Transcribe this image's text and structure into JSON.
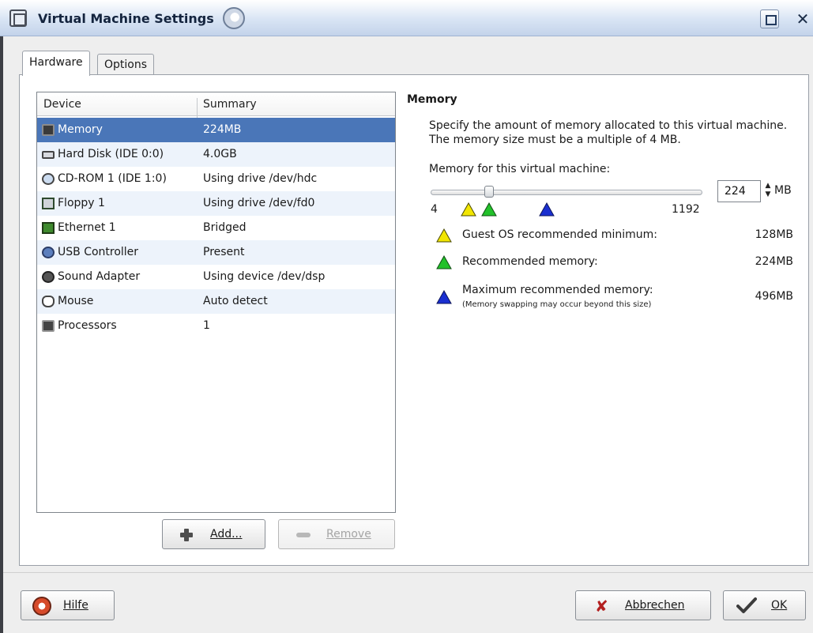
{
  "window": {
    "title": "Virtual Machine Settings"
  },
  "tabs": [
    {
      "label": "Hardware"
    },
    {
      "label": "Options"
    }
  ],
  "device_list": {
    "columns": [
      "Device",
      "Summary"
    ],
    "rows": [
      {
        "device": "Memory",
        "summary": "224MB",
        "icon": "memory-chip-icon"
      },
      {
        "device": "Hard Disk (IDE 0:0)",
        "summary": "4.0GB",
        "icon": "hard-disk-icon"
      },
      {
        "device": "CD-ROM 1 (IDE 1:0)",
        "summary": "Using drive /dev/hdc",
        "icon": "cdrom-icon"
      },
      {
        "device": "Floppy 1",
        "summary": "Using drive /dev/fd0",
        "icon": "floppy-icon"
      },
      {
        "device": "Ethernet 1",
        "summary": "Bridged",
        "icon": "ethernet-icon"
      },
      {
        "device": "USB Controller",
        "summary": "Present",
        "icon": "usb-icon"
      },
      {
        "device": "Sound Adapter",
        "summary": "Using device /dev/dsp",
        "icon": "sound-icon"
      },
      {
        "device": "Mouse",
        "summary": "Auto detect",
        "icon": "mouse-icon"
      },
      {
        "device": "Processors",
        "summary": "1",
        "icon": "processor-icon"
      }
    ],
    "selected_index": 0
  },
  "list_buttons": {
    "add_label": "Add...",
    "remove_label": "Remove"
  },
  "memory_panel": {
    "title": "Memory",
    "description": "Specify the amount of memory allocated to this virtual machine. The memory size must be a multiple of 4 MB.",
    "slider_label": "Memory for this virtual machine:",
    "min_label": "4",
    "max_label": "1192",
    "min_value": 4,
    "max_value": 1192,
    "value": 224,
    "value_text": "224",
    "unit": "MB",
    "markers": [
      {
        "name": "guest-os-minimum",
        "value": 128,
        "color": "#f2e600"
      },
      {
        "name": "recommended",
        "value": 224,
        "color": "#22c12a"
      },
      {
        "name": "maximum-recommended",
        "value": 496,
        "color": "#1a2fd0"
      }
    ],
    "legend": [
      {
        "text": "Guest OS recommended minimum:",
        "value": "128MB",
        "color": "#f2e600"
      },
      {
        "text": "Recommended memory:",
        "value": "224MB",
        "color": "#22c12a"
      },
      {
        "text": "Maximum recommended memory:",
        "value": "496MB",
        "color": "#1a2fd0",
        "note": "(Memory swapping may occur beyond this size)"
      }
    ]
  },
  "footer": {
    "help_label": "Hilfe",
    "cancel_label": "Abbrechen",
    "ok_label": "OK"
  }
}
